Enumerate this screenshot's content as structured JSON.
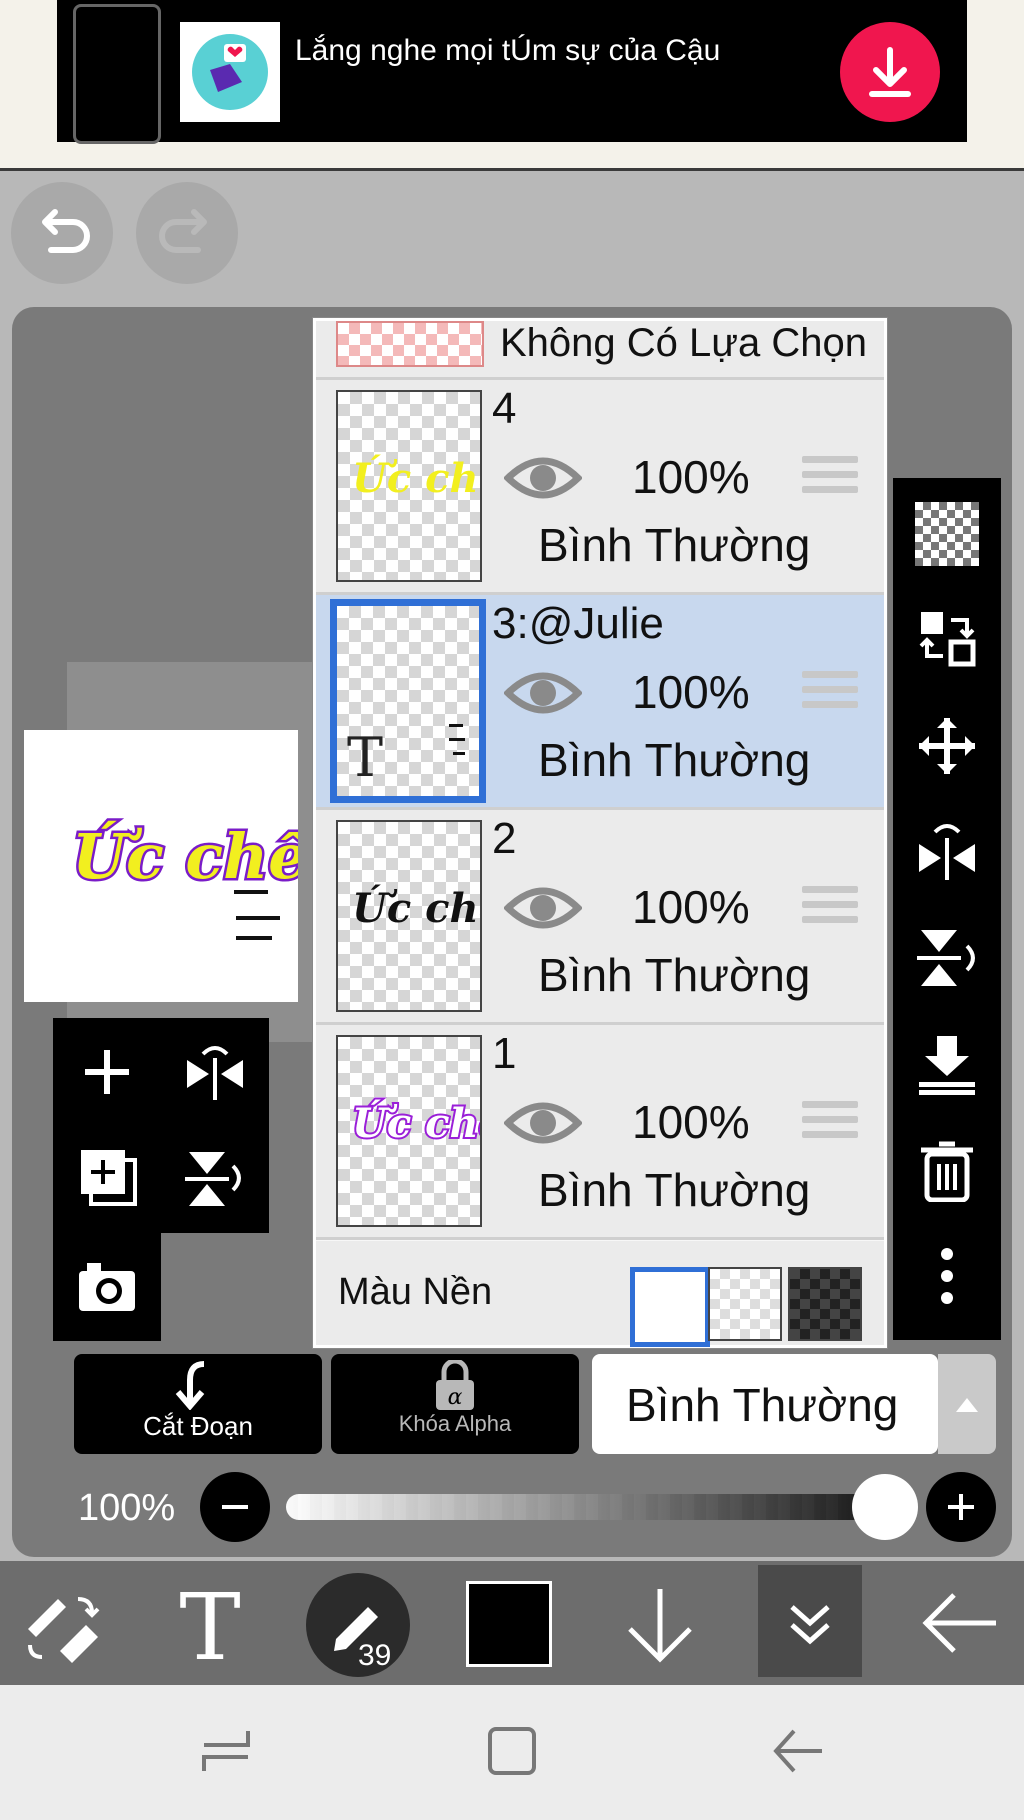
{
  "ad": {
    "text": "Lắng nghe mọi tÚm sự của Cậu",
    "icons": [
      "phone-icon",
      "app-icon",
      "download-icon"
    ],
    "accent": "#f0164e"
  },
  "toolbar_top": {
    "icons": [
      "undo-icon",
      "redo-icon"
    ]
  },
  "layers_panel": {
    "selection_label": "Không Có Lựa Chọn",
    "layers": [
      {
        "name": "4",
        "opacity": "100%",
        "blend": "Bình Thường",
        "selected": false
      },
      {
        "name": "3:@Julie",
        "opacity": "100%",
        "blend": "Bình Thường",
        "selected": true
      },
      {
        "name": "2",
        "opacity": "100%",
        "blend": "Bình Thường",
        "selected": false
      },
      {
        "name": "1",
        "opacity": "100%",
        "blend": "Bình Thường",
        "selected": false
      }
    ],
    "background": {
      "label": "Màu Nền",
      "options": [
        "white",
        "transparent",
        "dark-checker"
      ],
      "selected": "white"
    },
    "thumbnails": {
      "layer4_text": "Ức chế",
      "layer3_text": "T",
      "layer2_text": "Ức chế",
      "layer1_text": "Ức chế"
    }
  },
  "preview": {
    "title": "Ức chế"
  },
  "right_toolbar": {
    "icons": [
      "checker-icon",
      "swap-layer-icon",
      "move-icon",
      "flip-horizontal-icon",
      "flip-vertical-icon",
      "merge-down-icon",
      "trash-icon",
      "more-icon"
    ]
  },
  "left_menu": {
    "icons": [
      "add-layer-icon",
      "flip-h-icon",
      "add-copy-icon",
      "flip-v-icon",
      "camera-icon"
    ]
  },
  "controls": {
    "clip_label": "Cắt Đoạn",
    "alpha_lock_label": "Khóa Alpha",
    "blend_mode": "Bình Thường",
    "opacity_label": "100%",
    "opacity_value": 1.0
  },
  "bottom_toolbar": {
    "brush_size": "39",
    "color": "#000000"
  },
  "colors": {
    "selection": "#2f6fd6",
    "selected_row": "#c8d8ee"
  }
}
